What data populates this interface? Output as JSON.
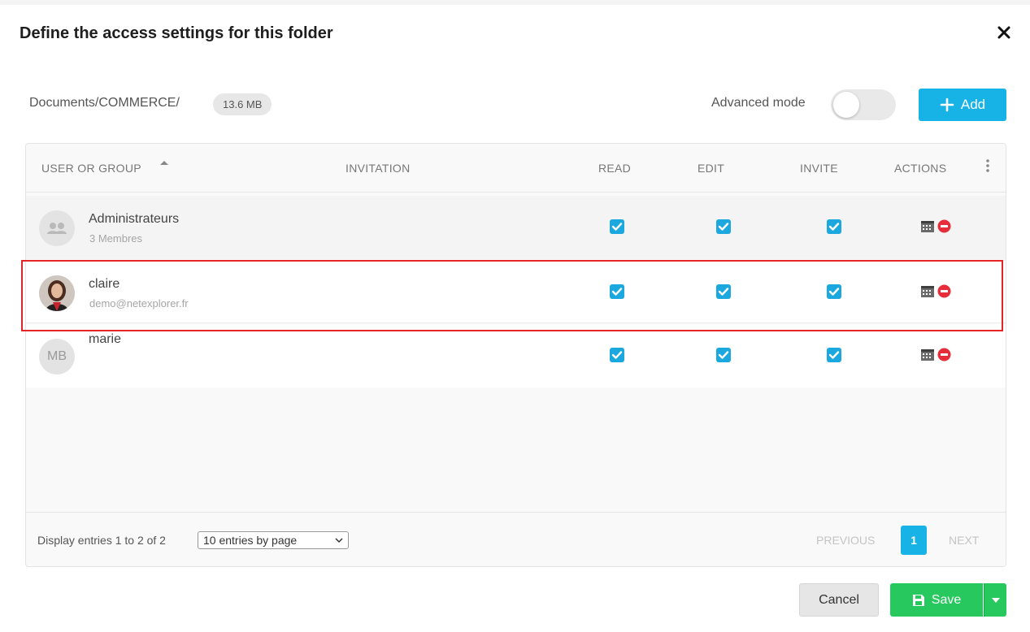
{
  "dialog": {
    "title": "Define the access settings for this folder"
  },
  "folder": {
    "path": "Documents/COMMERCE/",
    "size": "13.6 MB"
  },
  "toolbar": {
    "advanced_mode_label": "Advanced mode",
    "advanced_mode_on": false,
    "add_label": "Add"
  },
  "table": {
    "columns": [
      "USER OR GROUP",
      "INVITATION",
      "READ",
      "EDIT",
      "INVITE",
      "ACTIONS"
    ],
    "rows": [
      {
        "name": "Administrateurs",
        "subtitle": "3 Membres",
        "avatar": "group-icon",
        "read": true,
        "edit": true,
        "invite": true
      },
      {
        "name": "claire",
        "subtitle": "demo@netexplorer.fr",
        "avatar": "user-photo",
        "read": true,
        "edit": true,
        "invite": true,
        "highlighted": true
      },
      {
        "name": "marie",
        "subtitle": "",
        "avatar_initials": "MB",
        "read": true,
        "edit": true,
        "invite": true
      }
    ]
  },
  "footer": {
    "display_text": "Display entries 1 to 2 of 2",
    "entries_per_page": "10 entries by page",
    "previous_label": "PREVIOUS",
    "current_page": "1",
    "next_label": "NEXT"
  },
  "buttons": {
    "cancel_label": "Cancel",
    "save_label": "Save"
  },
  "colors": {
    "accent": "#17b3e6",
    "save": "#27c95e",
    "delete": "#e52e3a",
    "highlight": "#e32526"
  }
}
